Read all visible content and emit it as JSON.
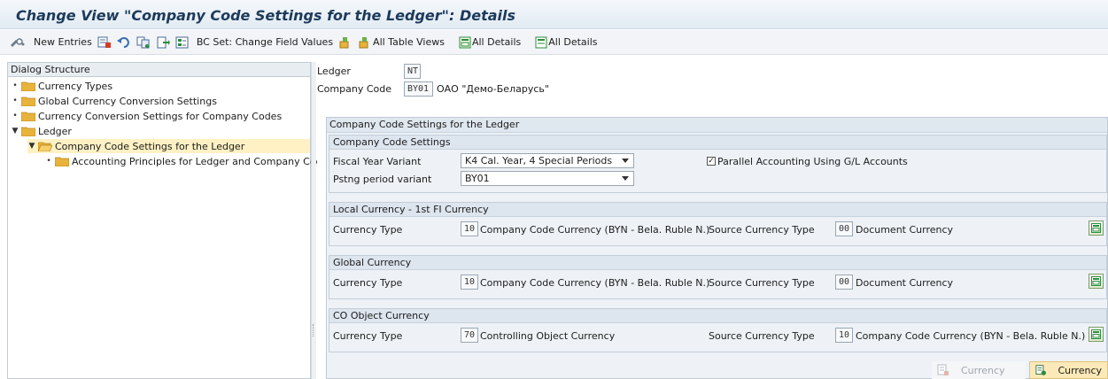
{
  "window": {
    "title": "Change View \"Company Code Settings for the Ledger\": Details"
  },
  "toolbar": {
    "items": [
      {
        "icon": "display-change-icon",
        "label": ""
      },
      {
        "icon": "",
        "label": "New Entries"
      },
      {
        "icon": "delete-icon",
        "label": ""
      },
      {
        "icon": "undo-icon",
        "label": ""
      },
      {
        "icon": "copy-icon",
        "label": ""
      },
      {
        "icon": "import-icon",
        "label": ""
      },
      {
        "icon": "select-icon",
        "label": ""
      }
    ],
    "bcset_label": "BC Set: Change Field Values",
    "all_table_views_label": "All Table Views",
    "all_details_1": "All Details",
    "all_details_2": "All Details"
  },
  "dialog": {
    "header": "Dialog Structure",
    "nodes": [
      {
        "label": "Currency Types",
        "bullet": "•"
      },
      {
        "label": "Global Currency Conversion Settings",
        "bullet": "•"
      },
      {
        "label": "Currency Conversion Settings for Company Codes",
        "bullet": "•"
      },
      {
        "label": "Ledger",
        "bullet": "▼"
      },
      {
        "label": "Company Code Settings for the Ledger",
        "bullet": "▼"
      },
      {
        "label": "Accounting Principles for Ledger and Company Code",
        "bullet": "•"
      }
    ]
  },
  "header_fields": {
    "ledger_label": "Ledger",
    "ledger_value": "NT",
    "company_code_label": "Company Code",
    "company_code_value": "BY01",
    "company_name": "ОАО \"Демо-Беларусь\""
  },
  "settings": {
    "title": "Company Code Settings for the Ledger",
    "company_code_settings": {
      "title": "Company Code Settings",
      "fiscal_year_label": "Fiscal Year Variant",
      "fiscal_year_value": "K4 Cal. Year, 4 Special Periods",
      "posting_period_label": "Pstng period variant",
      "posting_period_value": "BY01",
      "parallel_accounting_label": "Parallel Accounting Using G/L Accounts",
      "parallel_accounting_checked": true,
      "check_mark": "✓"
    },
    "local_currency": {
      "title": "Local Currency - 1st FI Currency",
      "type_label": "Currency Type",
      "type_value": "10",
      "type_text": "Company Code Currency (BYN - Bela. Ruble N.)",
      "source_label": "Source Currency Type",
      "source_value": "00",
      "source_text": "Document Currency"
    },
    "global_currency": {
      "title": "Global Currency",
      "type_label": "Currency Type",
      "type_value": "10",
      "type_text": "Company Code Currency (BYN - Bela. Ruble N.)",
      "source_label": "Source Currency Type",
      "source_value": "00",
      "source_text": "Document Currency"
    },
    "co_object_currency": {
      "title": "CO Object Currency",
      "type_label": "Currency Type",
      "type_value": "70",
      "type_text": "Controlling Object Currency",
      "source_label": "Source Currency Type",
      "source_value": "10",
      "source_text": "Company Code Currency (BYN - Bela. Ruble N.)"
    }
  },
  "footer": {
    "currency_disabled": "Currency",
    "currency_enabled": "Currency"
  },
  "colors": {
    "title": "#1d3a5b",
    "folder": "#e8b33d",
    "selected": "#fff1c4"
  }
}
